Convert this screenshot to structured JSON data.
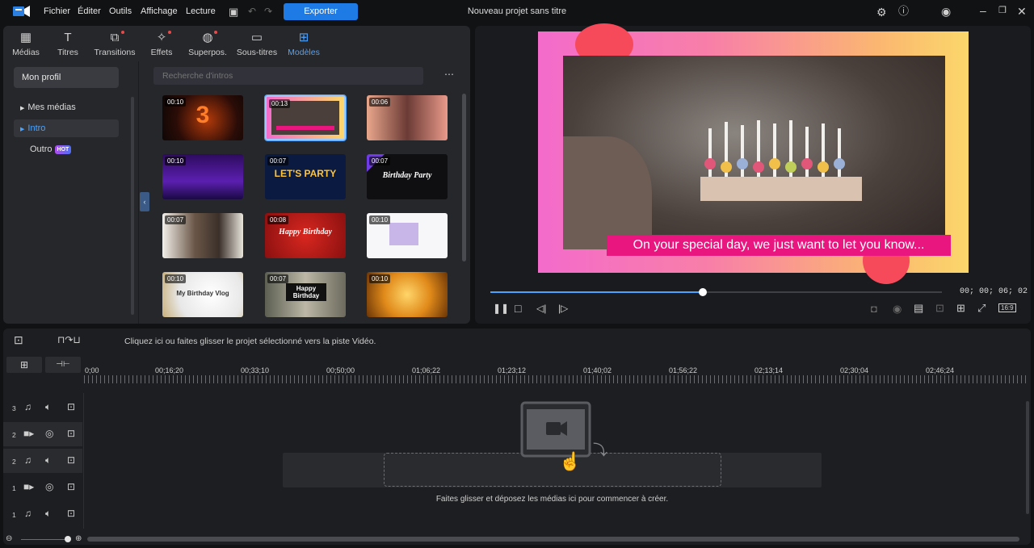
{
  "menu": [
    "Fichier",
    "Éditer",
    "Outils",
    "Affichage",
    "Lecture"
  ],
  "export_label": "Exporter",
  "window_title": "Nouveau projet sans titre",
  "tabs": [
    {
      "label": "Médias"
    },
    {
      "label": "Titres"
    },
    {
      "label": "Transitions"
    },
    {
      "label": "Effets"
    },
    {
      "label": "Superpos."
    },
    {
      "label": "Sous-titres"
    },
    {
      "label": "Modèles"
    }
  ],
  "sidebar": {
    "profile": "Mon profil",
    "items": [
      {
        "label": "Mes médias"
      },
      {
        "label": "Intro"
      },
      {
        "label": "Outro",
        "badge": "HOT"
      }
    ]
  },
  "search": {
    "placeholder": "Recherche d'intros"
  },
  "templates": [
    {
      "duration": "00:10",
      "text": "3"
    },
    {
      "duration": "00:13",
      "text": ""
    },
    {
      "duration": "00:06",
      "text": ""
    },
    {
      "duration": "00:10",
      "text": ""
    },
    {
      "duration": "00:07",
      "text": "LET'S PARTY"
    },
    {
      "duration": "00:07",
      "text": "Birthday Party"
    },
    {
      "duration": "00:07",
      "text": ""
    },
    {
      "duration": "00:08",
      "text": "Happy Birthday"
    },
    {
      "duration": "00:10",
      "text": ""
    },
    {
      "duration": "00:10",
      "text": "My Birthday Vlog"
    },
    {
      "duration": "00:07",
      "text": "Happy Birthday"
    },
    {
      "duration": "00:10",
      "text": ""
    }
  ],
  "preview": {
    "caption": "On your special day, we just want to let you know...",
    "timecode": "00; 00; 06; 02",
    "progress": 0.47,
    "aspect": "16:9"
  },
  "timeline": {
    "hint": "Cliquez ici ou faites glisser le projet sélectionné vers la piste Vidéo.",
    "ruler": [
      "0;00",
      "00;16;20",
      "00;33;10",
      "00;50;00",
      "01;06;22",
      "01;23;12",
      "01;40;02",
      "01;56;22",
      "02;13;14",
      "02;30;04",
      "02;46;24"
    ],
    "tracks": [
      {
        "num": "3",
        "type": "audio"
      },
      {
        "num": "2",
        "type": "video"
      },
      {
        "num": "2",
        "type": "audio"
      },
      {
        "num": "1",
        "type": "video"
      },
      {
        "num": "1",
        "type": "audio"
      }
    ],
    "drop_text": "Faites glisser et déposez les médias ici pour commencer à créer."
  }
}
